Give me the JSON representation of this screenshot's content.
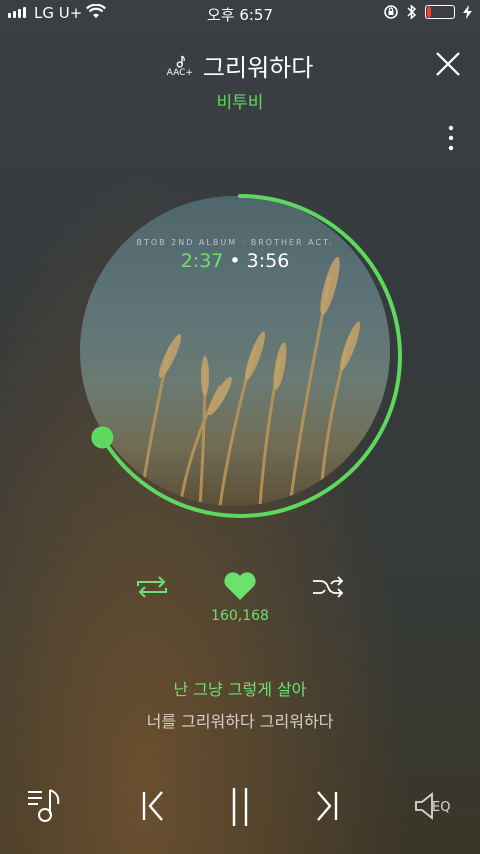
{
  "status_bar": {
    "carrier": "LG U+",
    "time": "오후 6:57"
  },
  "player": {
    "codec_label": "AAC+",
    "song_title": "그리워하다",
    "artist": "비투비",
    "album_label": "BTOB 2ND ALBUM · BROTHER ACT.",
    "elapsed": "2:37",
    "separator": "•",
    "duration": "3:56",
    "progress_fraction": 0.665,
    "like_count": "160,168",
    "lyric_current": "난 그냥 그렇게 살아",
    "lyric_next": "너를 그리워하다 그리워하다",
    "eq_label": "EQ"
  },
  "colors": {
    "accent": "#6ce26c",
    "battery_low": "#ff3b30"
  },
  "icons": [
    "signal-icon",
    "wifi-icon",
    "rotation-lock-icon",
    "bluetooth-icon",
    "battery-icon",
    "charging-icon",
    "music-note-icon",
    "close-icon",
    "more-icon",
    "repeat-icon",
    "heart-icon",
    "shuffle-icon",
    "playlist-icon",
    "previous-icon",
    "pause-icon",
    "next-icon",
    "speaker-icon"
  ]
}
